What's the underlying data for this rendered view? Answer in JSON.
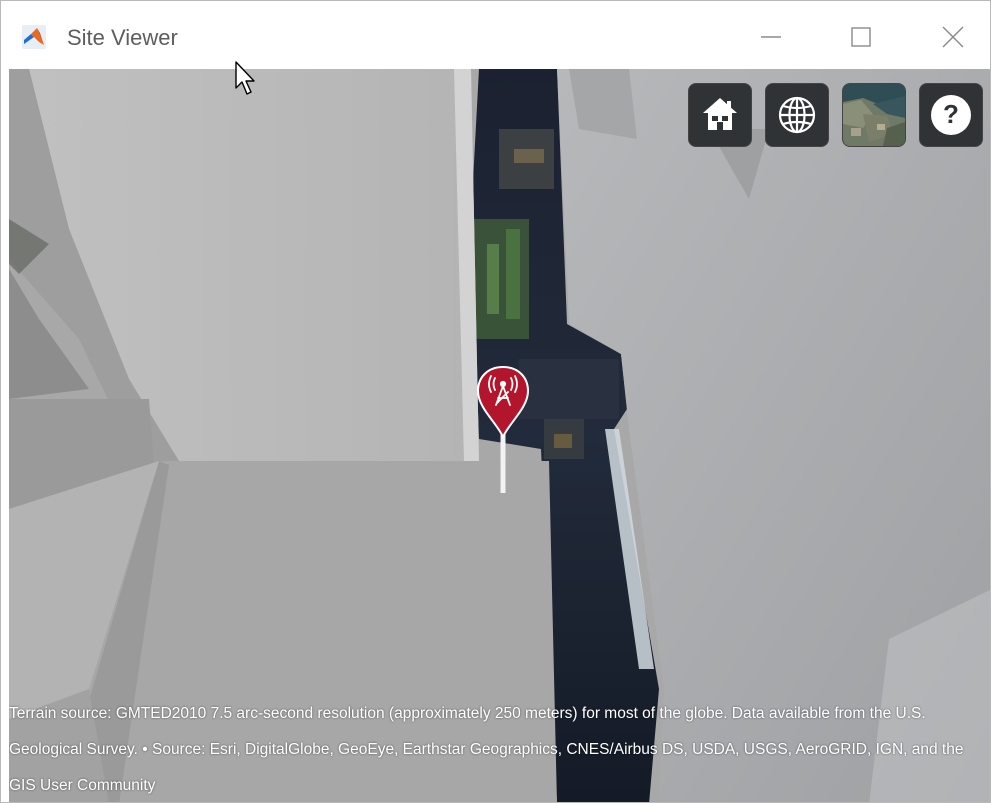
{
  "window": {
    "title": "Site Viewer",
    "app_icon": "matlab-icon",
    "controls": {
      "minimize": "minimize-icon",
      "maximize": "maximize-icon",
      "close": "close-icon"
    }
  },
  "toolbar": {
    "buttons": [
      {
        "name": "home-button",
        "icon": "home-icon"
      },
      {
        "name": "scene-mode-button",
        "icon": "globe-icon"
      },
      {
        "name": "base-layer-button",
        "icon": "satellite-imagery-icon"
      },
      {
        "name": "help-button",
        "icon": "question-mark-icon"
      }
    ]
  },
  "map": {
    "marker_icon": "cell-tower-icon",
    "marker_color": "#b3162c",
    "attribution": "Terrain source: GMTED2010 7.5 arc-second resolution (approximately 250 meters) for most of the globe. Data available from the U.S. Geological Survey. • Source: Esri, DigitalGlobe, GeoEye, Earthstar Geographics, CNES/Airbus DS, USDA, USGS, AeroGRID, IGN, and the GIS User Community"
  }
}
